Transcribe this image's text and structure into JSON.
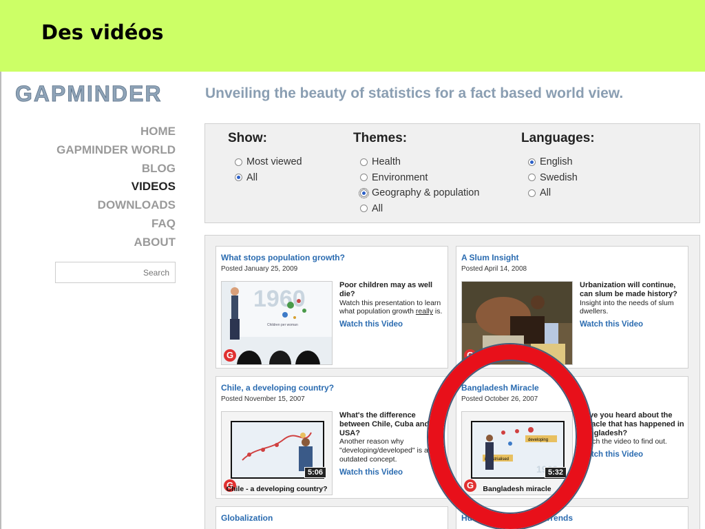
{
  "slide": {
    "title": "Des vidéos"
  },
  "site": {
    "logo": "GAPMINDER",
    "tagline": "Unveiling the beauty of statistics for a fact based world view."
  },
  "nav": {
    "items": [
      {
        "label": "HOME"
      },
      {
        "label": "GAPMINDER WORLD"
      },
      {
        "label": "BLOG"
      },
      {
        "label": "VIDEOS"
      },
      {
        "label": "DOWNLOADS"
      },
      {
        "label": "FAQ"
      },
      {
        "label": "ABOUT"
      }
    ],
    "active": "VIDEOS",
    "search_placeholder": "Search"
  },
  "filters": {
    "show": {
      "title": "Show:",
      "options": [
        "Most viewed",
        "All"
      ],
      "selected": "All"
    },
    "themes": {
      "title": "Themes:",
      "options": [
        "Health",
        "Environment",
        "Geography & population",
        "All"
      ],
      "selected": "Geography & population"
    },
    "languages": {
      "title": "Languages:",
      "options": [
        "English",
        "Swedish",
        "All"
      ],
      "selected": "English"
    }
  },
  "videos": [
    {
      "title": "What stops population growth?",
      "date": "Posted January 25, 2009",
      "headline": "Poor children may as well die?",
      "text_before": "Watch this presentation to learn what population growth ",
      "text_link": "really",
      "text_after": " is.",
      "watch": "Watch this Video",
      "thumb_year": "1960",
      "thumb_axis": "Children per woman"
    },
    {
      "title": "A Slum Insight",
      "date": "Posted April 14, 2008",
      "headline": "Urbanization will continue, can slum be made history?",
      "text_before": "Insight into the needs of slum dwellers.",
      "watch": "Watch this Video"
    },
    {
      "title": "Chile, a developing country?",
      "date": "Posted November 15, 2007",
      "headline": "What's the difference between Chile, Cuba and the USA?",
      "text_before": "Another reason why \"developing/developed\" is an outdated concept.",
      "watch": "Watch this Video",
      "duration": "5:06",
      "caption": "Chile - a developing country?"
    },
    {
      "title": "Bangladesh Miracle",
      "date": "Posted October 26, 2007",
      "headline": "Have you heard about the miracle that has happened in Bangladesh?",
      "text_before": "Watch the video to find out.",
      "watch": "Watch this Video",
      "duration": "5:32",
      "caption": "Bangladesh miracle",
      "thumb_label1": "developing",
      "thumb_label2": "industrialised",
      "thumb_year": "1962"
    },
    {
      "title": "Globalization"
    },
    {
      "title": "Human Development Trends"
    }
  ],
  "colors": {
    "slide_header": "#ccff66",
    "link": "#2a6bb0",
    "annotation_circle": "#e8101a"
  }
}
